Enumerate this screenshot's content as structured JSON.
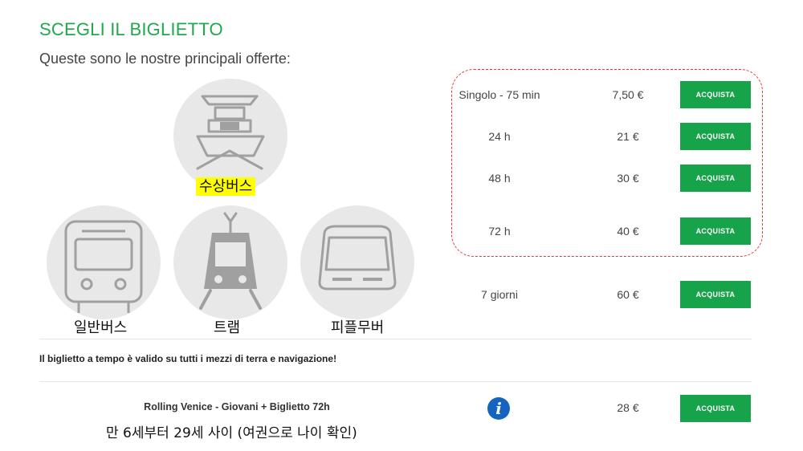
{
  "header": {
    "title": "SCEGLI IL BIGLIETTO",
    "subtitle": "Queste sono le nostre principali offerte:"
  },
  "transport": {
    "waterbus": "수상버스",
    "bus": "일반버스",
    "tram": "트램",
    "people_mover": "피플무버"
  },
  "tickets": [
    {
      "name": "Singolo - 75 min",
      "price": "7,50 €",
      "button": "ACQUISTA"
    },
    {
      "name": "24 h",
      "price": "21 €",
      "button": "ACQUISTA"
    },
    {
      "name": "48 h",
      "price": "30 €",
      "button": "ACQUISTA"
    },
    {
      "name": "72 h",
      "price": "40 €",
      "button": "ACQUISTA"
    },
    {
      "name": "7 giorni",
      "price": "60 €",
      "button": "ACQUISTA"
    }
  ],
  "note": "Il biglietto a tempo è valido su tutti i mezzi di terra e navigazione!",
  "rolling": {
    "name": "Rolling Venice - Giovani + Biglietto 72h",
    "ages": "만 6세부터 29세 사이 (여권으로 나이 확인)",
    "price": "28 €",
    "button": "ACQUISTA",
    "info_icon": "info-icon"
  },
  "colors": {
    "accent": "#1fa84c",
    "button": "#17a34a",
    "highlight": "#ffff00",
    "dashed_border": "#e53935",
    "info": "#1565c0"
  }
}
